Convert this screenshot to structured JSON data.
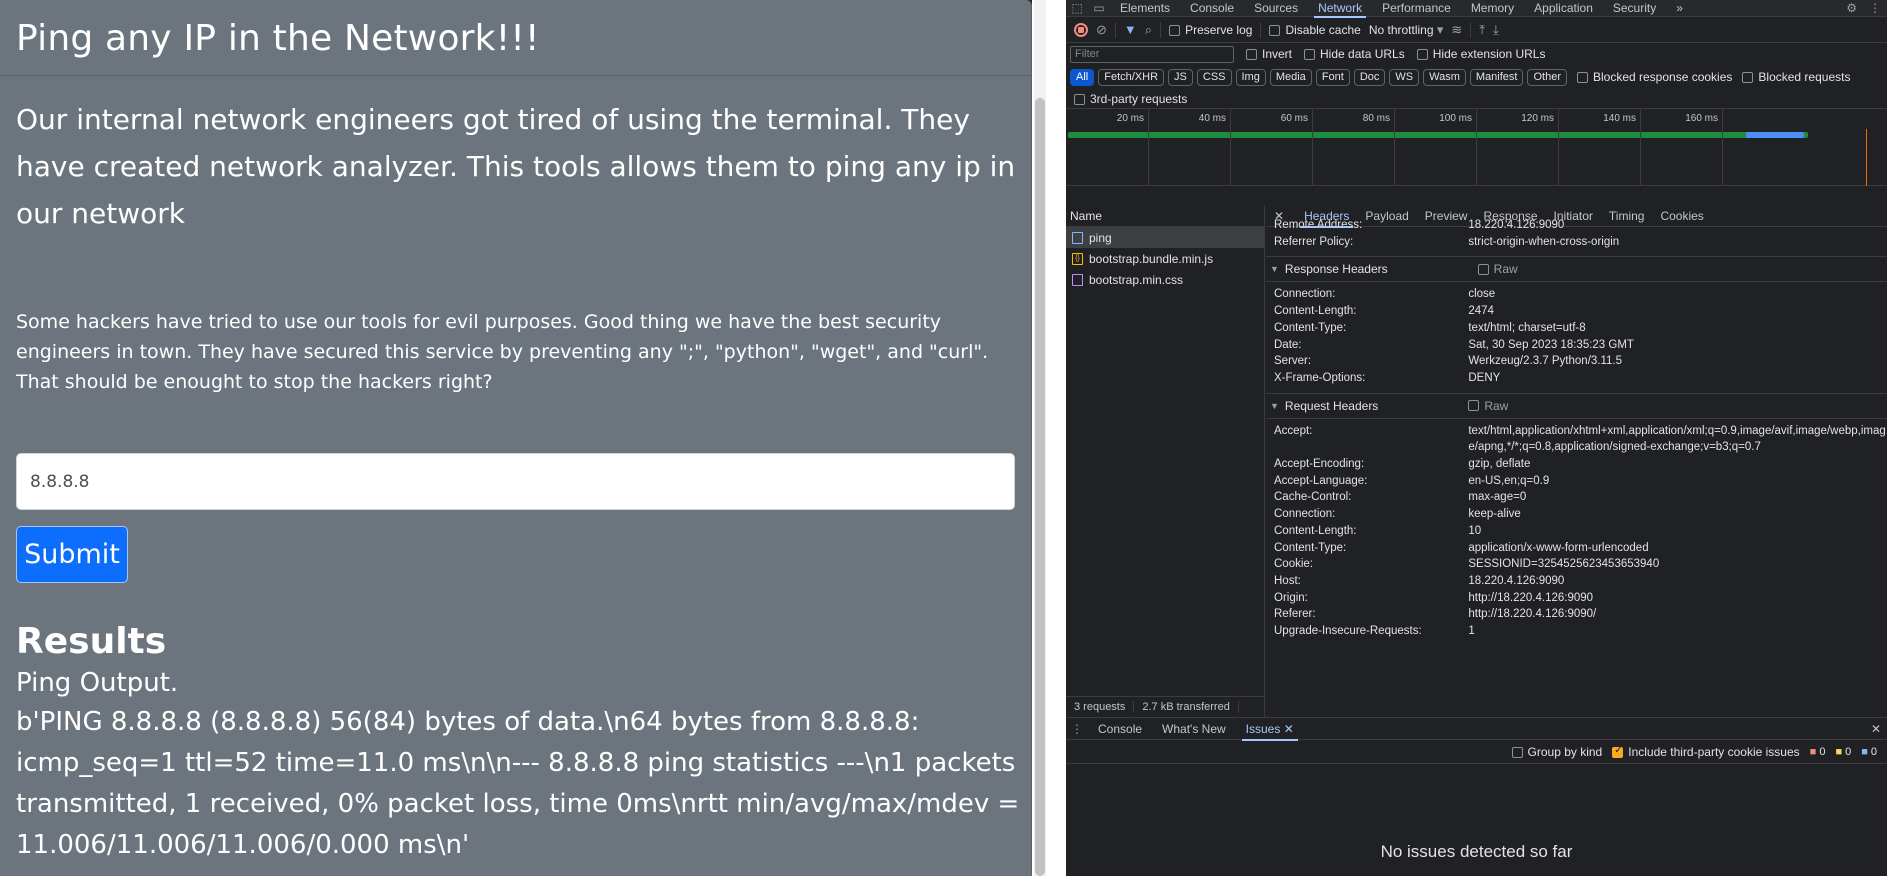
{
  "page": {
    "title": "Ping any IP in the Network!!!",
    "intro": "Our internal network engineers got tired of using the terminal. They have created network analyzer. This tools allows them to ping any ip in our network",
    "warning": "Some hackers have tried to use our tools for evil purposes. Good thing we have the best security engineers in town. They have secured this service by preventing any \";\", \"python\", \"wget\", and \"curl\". That should be enought to stop the hackers right?",
    "ip_value": "8.8.8.8",
    "submit_label": "Submit",
    "results_title": "Results",
    "ping_label": "Ping Output.",
    "ping_output": "b'PING 8.8.8.8 (8.8.8.8) 56(84) bytes of data.\\n64 bytes from 8.8.8.8: icmp_seq=1 ttl=52 time=11.0 ms\\n\\n--- 8.8.8.8 ping statistics ---\\n1 packets transmitted, 1 received, 0% packet loss, time 0ms\\nrtt min/avg/max/mdev = 11.006/11.006/11.006/0.000 ms\\n'"
  },
  "devtools": {
    "tabs": [
      "Elements",
      "Console",
      "Sources",
      "Network",
      "Performance",
      "Memory",
      "Application",
      "Security"
    ],
    "active_tab": "Network",
    "more": "»",
    "toolbar": {
      "preserve_log": "Preserve log",
      "disable_cache": "Disable cache",
      "throttling": "No throttling"
    },
    "filter": {
      "placeholder": "Filter",
      "invert": "Invert",
      "hide_data_urls": "Hide data URLs",
      "hide_extension_urls": "Hide extension URLs"
    },
    "types": [
      "All",
      "Fetch/XHR",
      "JS",
      "CSS",
      "Img",
      "Media",
      "Font",
      "Doc",
      "WS",
      "Wasm",
      "Manifest",
      "Other"
    ],
    "blocked_response_cookies": "Blocked response cookies",
    "blocked_requests": "Blocked requests",
    "third_party": "3rd-party requests",
    "timeline_ticks": [
      "20 ms",
      "40 ms",
      "60 ms",
      "80 ms",
      "100 ms",
      "120 ms",
      "140 ms",
      "160 ms"
    ],
    "requests": {
      "header": "Name",
      "items": [
        {
          "name": "ping",
          "kind": "doc"
        },
        {
          "name": "bootstrap.bundle.min.js",
          "kind": "js"
        },
        {
          "name": "bootstrap.min.css",
          "kind": "css"
        }
      ],
      "count": "3 requests",
      "transferred": "2.7 kB transferred"
    },
    "detail_tabs": [
      "Headers",
      "Payload",
      "Preview",
      "Response",
      "Initiator",
      "Timing",
      "Cookies"
    ],
    "general": [
      {
        "k": "Remote Address:",
        "v": "18.220.4.126:9090"
      },
      {
        "k": "Referrer Policy:",
        "v": "strict-origin-when-cross-origin"
      }
    ],
    "response_headers_title": "Response Headers",
    "response_headers": [
      {
        "k": "Connection:",
        "v": "close"
      },
      {
        "k": "Content-Length:",
        "v": "2474"
      },
      {
        "k": "Content-Type:",
        "v": "text/html; charset=utf-8"
      },
      {
        "k": "Date:",
        "v": "Sat, 30 Sep 2023 18:35:23 GMT"
      },
      {
        "k": "Server:",
        "v": "Werkzeug/2.3.7 Python/3.11.5"
      },
      {
        "k": "X-Frame-Options:",
        "v": "DENY"
      }
    ],
    "request_headers_title": "Request Headers",
    "raw_label": "Raw",
    "request_headers": [
      {
        "k": "Accept:",
        "v": "text/html,application/xhtml+xml,application/xml;q=0.9,image/avif,image/webp,image/apng,*/*;q=0.8,application/signed-exchange;v=b3;q=0.7"
      },
      {
        "k": "Accept-Encoding:",
        "v": "gzip, deflate"
      },
      {
        "k": "Accept-Language:",
        "v": "en-US,en;q=0.9"
      },
      {
        "k": "Cache-Control:",
        "v": "max-age=0"
      },
      {
        "k": "Connection:",
        "v": "keep-alive"
      },
      {
        "k": "Content-Length:",
        "v": "10"
      },
      {
        "k": "Content-Type:",
        "v": "application/x-www-form-urlencoded"
      },
      {
        "k": "Cookie:",
        "v": "SESSIONID=3254525623453653940"
      },
      {
        "k": "Host:",
        "v": "18.220.4.126:9090"
      },
      {
        "k": "Origin:",
        "v": "http://18.220.4.126:9090"
      },
      {
        "k": "Referer:",
        "v": "http://18.220.4.126:9090/"
      },
      {
        "k": "Upgrade-Insecure-Requests:",
        "v": "1"
      }
    ],
    "drawer": {
      "tabs": [
        "Console",
        "What's New",
        "Issues"
      ],
      "active": "Issues",
      "group_by_kind": "Group by kind",
      "include_third_party": "Include third-party cookie issues",
      "counts": [
        "0",
        "0",
        "0"
      ],
      "empty_message": "No issues detected so far"
    }
  },
  "colors": {
    "page_bg": "#6c757d",
    "primary": "#0d6efd",
    "devtools_bg": "#202124",
    "accent": "#a8c7fa"
  }
}
